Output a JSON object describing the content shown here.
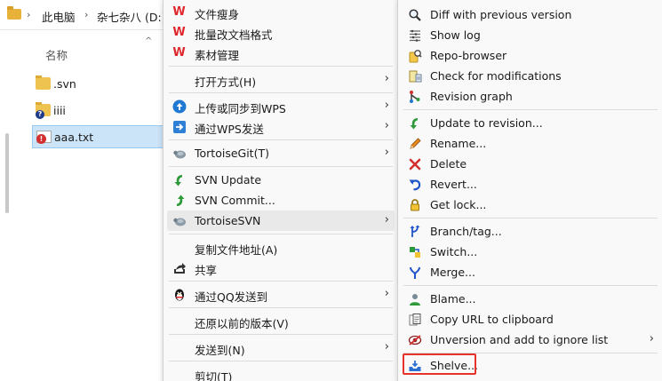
{
  "explorer": {
    "breadcrumb": [
      "此电脑",
      "杂七杂八 (D:)"
    ],
    "column_header": "名称",
    "files": [
      {
        "name": ".svn",
        "type": "folder"
      },
      {
        "name": "iiii",
        "type": "folder-question"
      },
      {
        "name": "aaa.txt",
        "type": "text-error",
        "selected": true
      }
    ]
  },
  "menu1": {
    "items": [
      {
        "label": "文件瘦身",
        "icon": "wps-icon"
      },
      {
        "label": "批量改文档格式",
        "icon": "wps-icon"
      },
      {
        "label": "素材管理",
        "icon": "wps-icon"
      },
      {
        "label": "打开方式(H)",
        "icon": "",
        "submenu": true
      },
      {
        "label": "上传或同步到WPS",
        "icon": "cloud-upload-icon",
        "submenu": true
      },
      {
        "label": "通过WPS发送",
        "icon": "send-arrow-icon",
        "submenu": true
      },
      {
        "label": "TortoiseGit(T)",
        "icon": "tortoise-icon",
        "submenu": true
      },
      {
        "label": "SVN Update",
        "icon": "svn-update-icon"
      },
      {
        "label": "SVN Commit...",
        "icon": "svn-commit-icon"
      },
      {
        "label": "TortoiseSVN",
        "icon": "tortoise-icon",
        "submenu": true,
        "hover": true
      },
      {
        "label": "复制文件地址(A)",
        "icon": ""
      },
      {
        "label": "共享",
        "icon": "share-icon"
      },
      {
        "label": "通过QQ发送到",
        "icon": "qq-penguin-icon",
        "submenu": true
      },
      {
        "label": "还原以前的版本(V)",
        "icon": ""
      },
      {
        "label": "发送到(N)",
        "icon": "",
        "submenu": true
      },
      {
        "label": "剪切(T)",
        "icon": ""
      }
    ]
  },
  "menu2": {
    "items": [
      {
        "label": "Diff with previous version",
        "icon": "diff-magnifier-icon"
      },
      {
        "label": "Show log",
        "icon": "show-log-icon"
      },
      {
        "label": "Repo-browser",
        "icon": "repo-browser-icon"
      },
      {
        "label": "Check for modifications",
        "icon": "check-modifications-icon"
      },
      {
        "label": "Revision graph",
        "icon": "revision-graph-icon"
      },
      {
        "label": "Update to revision...",
        "icon": "update-revision-icon"
      },
      {
        "label": "Rename...",
        "icon": "rename-pencil-icon"
      },
      {
        "label": "Delete",
        "icon": "delete-x-icon"
      },
      {
        "label": "Revert...",
        "icon": "revert-arrow-icon"
      },
      {
        "label": "Get lock...",
        "icon": "lock-icon"
      },
      {
        "label": "Branch/tag...",
        "icon": "branch-tag-icon"
      },
      {
        "label": "Switch...",
        "icon": "switch-icon"
      },
      {
        "label": "Merge...",
        "icon": "merge-icon"
      },
      {
        "label": "Blame...",
        "icon": "blame-user-icon"
      },
      {
        "label": "Copy URL to clipboard",
        "icon": "clipboard-icon"
      },
      {
        "label": "Unversion and add to ignore list",
        "icon": "ignore-eye-icon",
        "submenu": true
      },
      {
        "label": "Shelve...",
        "icon": "shelve-inbox-icon",
        "highlighted": true
      }
    ]
  },
  "colors": {
    "highlight_box": "#e5322a",
    "selection": "#cce4f7",
    "menu_bg": "#f9f9f9",
    "wps_red": "#e0262d"
  }
}
